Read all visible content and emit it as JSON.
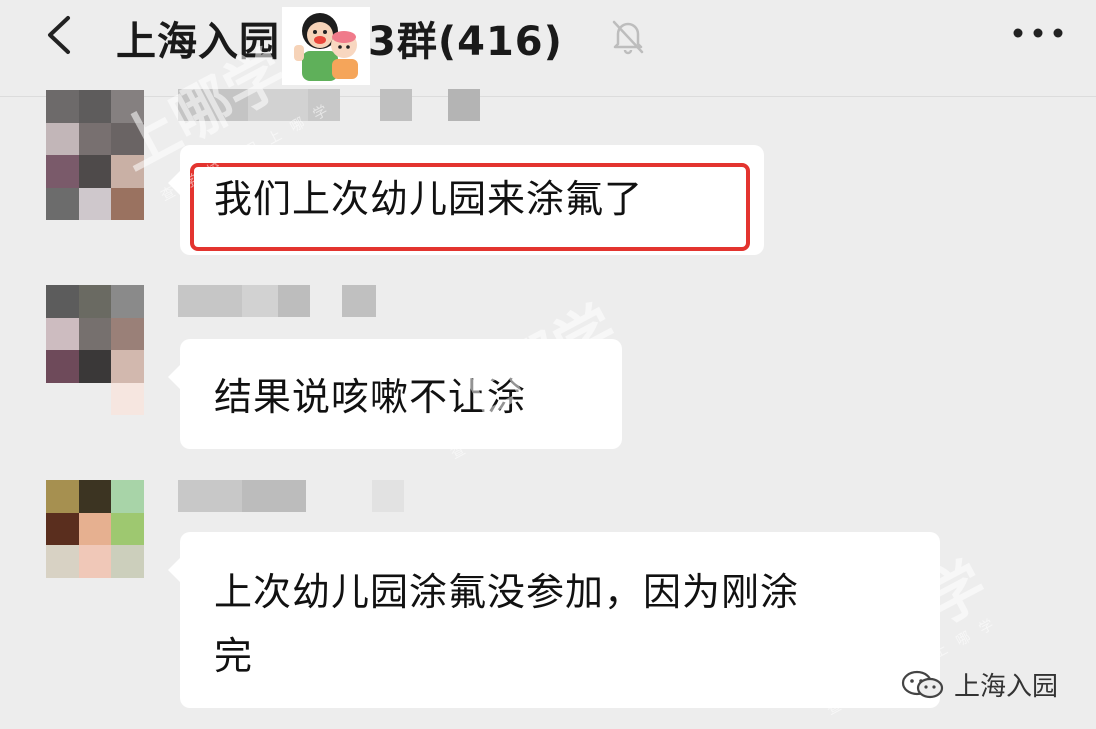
{
  "header": {
    "title_prefix": "上海入园",
    "title_suffix": "3群(416)",
    "back_icon": "chevron-left-icon",
    "mute_icon": "bell-off-icon",
    "more_icon": "more-dots-icon"
  },
  "messages": [
    {
      "text": "我们上次幼儿园来涂氟了",
      "highlighted": true
    },
    {
      "text": "结果说咳嗽不让涂",
      "highlighted": false
    },
    {
      "text_line1": "上次幼儿园涂氟没参加，因为刚涂",
      "text_line2": "完",
      "highlighted": false
    }
  ],
  "watermark": {
    "main": "上哪学",
    "sub": "查学校 用上哪学"
  },
  "brand": {
    "name": "上海入园",
    "icon": "wechat-icon"
  },
  "colors": {
    "background": "#ededed",
    "bubble": "#ffffff",
    "highlight": "#e3342f"
  }
}
